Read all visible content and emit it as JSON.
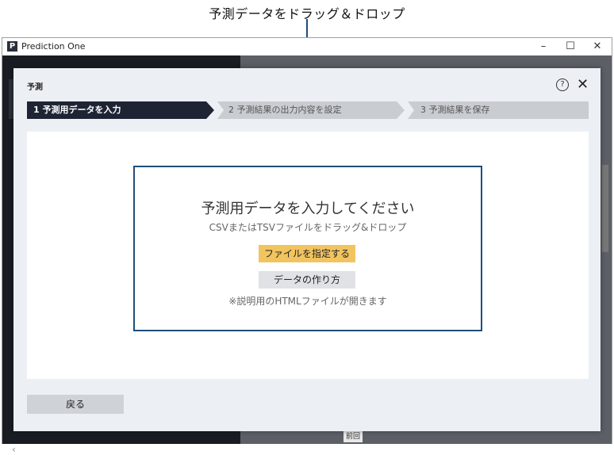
{
  "annotation": "予測データをドラッグ＆ドロップ",
  "window": {
    "title": "Prediction One",
    "logo": "P",
    "minimize": "–",
    "maximize": "☐",
    "close": "✕"
  },
  "background": {
    "bottom_label": "前回"
  },
  "modal": {
    "title": "予測",
    "help_icon": "?",
    "close_icon": "✕",
    "steps": [
      {
        "label": "1 予測用データを入力"
      },
      {
        "label": "2 予測結果の出力内容を設定"
      },
      {
        "label": "3 予測結果を保存"
      }
    ],
    "drop_zone": {
      "title": "予測用データを入力してください",
      "subtitle": "CSVまたはTSVファイルをドラッグ&ドロップ",
      "select_button": "ファイルを指定する",
      "howto_button": "データの作り方",
      "note": "※説明用のHTMLファイルが開きます"
    },
    "back_button": "戻る"
  },
  "colors": {
    "accent_yellow": "#f2c45f",
    "active_step": "#1e2433",
    "annotation_blue": "#1f4e79"
  }
}
